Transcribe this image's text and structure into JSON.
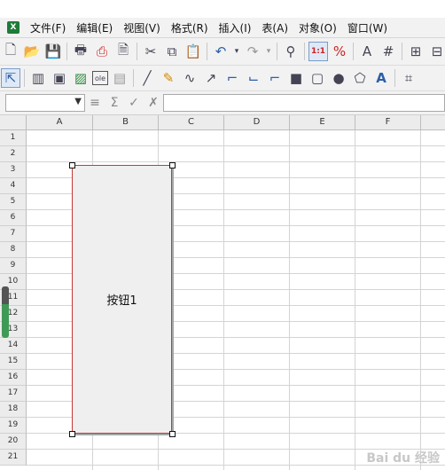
{
  "menubar": {
    "app_icon": "X",
    "items": [
      "文件(F)",
      "编辑(E)",
      "视图(V)",
      "格式(R)",
      "插入(I)",
      "表(A)",
      "对象(O)",
      "窗口(W)"
    ]
  },
  "toolbar1": {
    "icons": [
      "new-doc-icon",
      "open-folder-icon",
      "save-icon",
      "print-icon",
      "export-pdf-icon",
      "print-preview-icon",
      "cut-icon",
      "copy-icon",
      "paste-icon",
      "undo-icon",
      "redo-icon",
      "find-icon",
      "actual-size-icon",
      "zoom-icon",
      "text-frame-icon",
      "grid-icon",
      "table-icon"
    ],
    "zoom_label": "1:1"
  },
  "toolbar2": {
    "icons": [
      "select-arrow-icon",
      "column-icon",
      "frame-icon",
      "image-icon",
      "ole-icon",
      "chart-icon",
      "line-icon",
      "pen-icon",
      "curve-icon",
      "arrow-icon",
      "connector-icon",
      "connector2-icon",
      "connector3-icon",
      "rectangle-icon",
      "rounded-rect-icon",
      "ellipse-icon",
      "shapes-icon",
      "fontwork-icon"
    ],
    "ole_label": "ole"
  },
  "formula_bar": {
    "name_box": "",
    "formula": ""
  },
  "sheet": {
    "columns": [
      "A",
      "B",
      "C",
      "D",
      "E",
      "F"
    ],
    "rows": [
      "1",
      "2",
      "3",
      "4",
      "5",
      "6",
      "7",
      "8",
      "9",
      "10",
      "11",
      "12",
      "13",
      "14",
      "15",
      "16",
      "17",
      "18",
      "19",
      "20",
      "21"
    ]
  },
  "form_button": {
    "label": "按钮1"
  },
  "watermark": "Bai du 经验"
}
